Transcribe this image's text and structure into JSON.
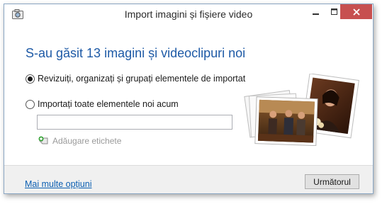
{
  "window": {
    "title": "Import imagini și fișiere video",
    "app_icon": "camera-icon",
    "controls": [
      "minimize-icon",
      "maximize-icon",
      "close-icon"
    ]
  },
  "main": {
    "heading": "S-au găsit 13 imagini și videoclipuri noi",
    "options": [
      {
        "label": "Revizuiți, organizați și grupați elementele de importat",
        "selected": true
      },
      {
        "label": "Importați toate elementele noi acum",
        "selected": false
      }
    ],
    "tag_input": {
      "value": "",
      "placeholder": ""
    },
    "add_tags_label": "Adăugare etichete",
    "add_tags_icon": "tag-add-icon"
  },
  "footer": {
    "more_options_link": "Mai multe opțiuni",
    "next_button": "Următorul"
  },
  "colors": {
    "heading": "#1e5aa6",
    "link": "#0b5fb2",
    "close_button": "#c75050",
    "footer_bg": "#f0f0f0"
  }
}
